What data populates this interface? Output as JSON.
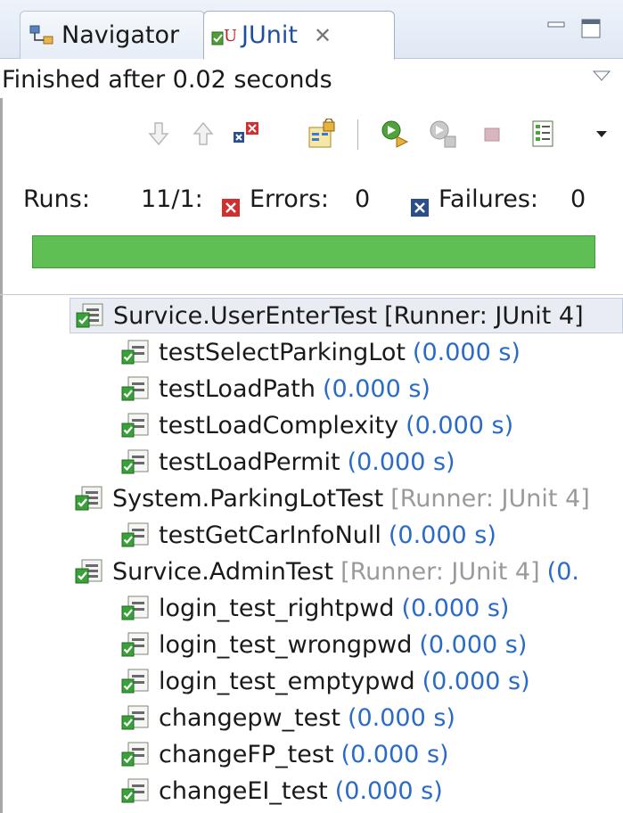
{
  "tabs": {
    "navigator": "Navigator",
    "junit_prefix": "J",
    "junit_label": "Unit"
  },
  "status": {
    "text": "Finished after 0.02 seconds"
  },
  "counters": {
    "runs_label": "Runs:",
    "runs_value": "11/1:",
    "errors_label": "Errors:",
    "errors_value": "0",
    "failures_label": "Failures:",
    "failures_value": "0"
  },
  "progress": {
    "fraction": 1.0,
    "color": "#5fbf55"
  },
  "tree": {
    "suites": [
      {
        "name": "Survice.UserEnterTest",
        "runner": "[Runner: JUnit 4]",
        "tests": [
          {
            "name": "testSelectParkingLot",
            "time": "(0.000 s)"
          },
          {
            "name": "testLoadPath",
            "time": "(0.000 s)"
          },
          {
            "name": "testLoadComplexity",
            "time": "(0.000 s)"
          },
          {
            "name": "testLoadPermit",
            "time": "(0.000 s)"
          }
        ]
      },
      {
        "name": "System.ParkingLotTest",
        "runner": "[Runner: JUnit 4]",
        "tests": [
          {
            "name": "testGetCarInfoNull",
            "time": "(0.000 s)"
          }
        ]
      },
      {
        "name": "Survice.AdminTest",
        "runner": "[Runner: JUnit 4]",
        "suite_time": "(0.",
        "tests": [
          {
            "name": "login_test_rightpwd",
            "time": "(0.000 s)"
          },
          {
            "name": "login_test_wrongpwd",
            "time": "(0.000 s)"
          },
          {
            "name": "login_test_emptypwd",
            "time": "(0.000 s)"
          },
          {
            "name": "changepw_test",
            "time": "(0.000 s)"
          },
          {
            "name": "changeFP_test",
            "time": "(0.000 s)"
          },
          {
            "name": "changeEI_test",
            "time": "(0.000 s)"
          }
        ]
      }
    ]
  },
  "colors": {
    "pass_green": "#3aa13a",
    "error_red": "#d03030",
    "failure_blue": "#2c4f8c",
    "time_blue": "#2a6bc8",
    "runner_grey": "#9a9a9a"
  }
}
